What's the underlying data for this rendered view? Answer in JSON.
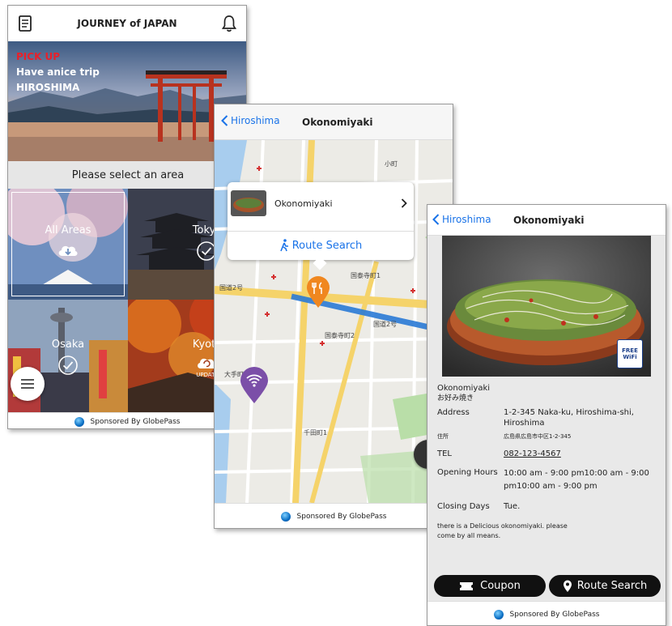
{
  "screen1": {
    "title": "JOURNEY of JAPAN",
    "banner": {
      "pickup": "PICK UP",
      "line1": "Have anice trip",
      "line2": "HIROSHIMA"
    },
    "prompt": "Please select an area",
    "areas": [
      {
        "label": "All Areas",
        "status": "cloud-download-icon"
      },
      {
        "label": "Tokyo",
        "status": "check-circle-icon"
      },
      {
        "label": "Osaka",
        "status": "check-circle-icon"
      },
      {
        "label": "Kyoto",
        "status": "update-icon",
        "status_text": "UPDATE"
      }
    ],
    "sponsor": "Sponsored By GlobePass"
  },
  "screen2": {
    "back_label": "Hiroshima",
    "title": "Okonomiyaki",
    "popup": {
      "name": "Okonomiyaki",
      "route_label": "Route Search"
    },
    "map_labels": [
      "国泰寺町1",
      "国泰寺町2",
      "国道2号",
      "国道2号",
      "千田町1",
      "大手町",
      "小町"
    ],
    "sponsor": "Sponsored By GlobePass"
  },
  "screen3": {
    "back_label": "Hiroshima",
    "title": "Okonomiyaki",
    "wifi_badge": "FREE WiFi",
    "name_en": "Okonomiyaki",
    "name_jp": "お好み焼き",
    "fields": {
      "address_label": "Address",
      "address_value": "1-2-345 Naka-ku, Hiroshima-shi, Hiroshima",
      "address_jp_label": "住所",
      "address_jp_value": "広島県広島市中区1-2-345",
      "tel_label": "TEL",
      "tel_value": "082-123-4567",
      "hours_label": "Opening Hours",
      "hours_value": "10:00 am - 9:00 pm10:00 am - 9:00 pm10:00 am - 9:00 pm",
      "closing_label": "Closing Days",
      "closing_value": "Tue."
    },
    "description": "there is a Delicious okonomiyaki. please come by all means.",
    "coupon_label": "Coupon",
    "route_label": "Route Search",
    "sponsor": "Sponsored By GlobePass"
  },
  "colors": {
    "ios_blue": "#1a73e8",
    "food_pin": "#f0871f",
    "wifi_pin": "#7b4fa8",
    "route_line": "#2b7bd6",
    "pickup_red": "#e8202a"
  }
}
